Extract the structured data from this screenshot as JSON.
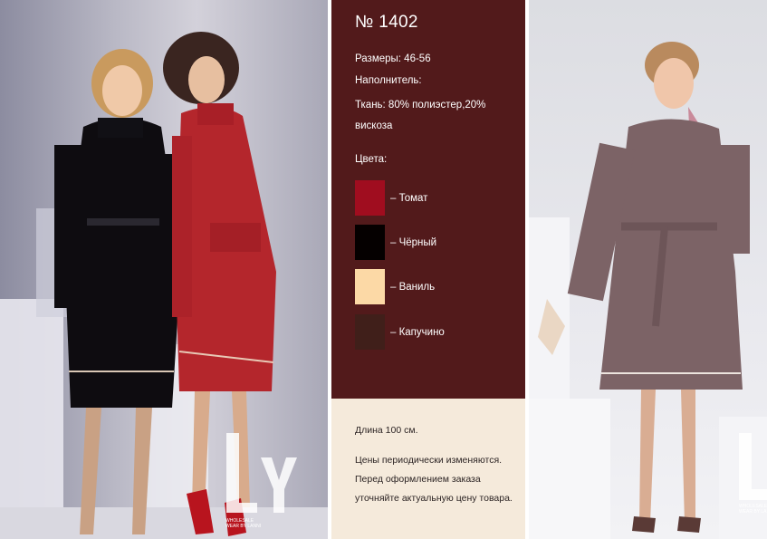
{
  "product": {
    "number": "№ 1402",
    "sizes": "Размеры: 46-56",
    "filler": "Наполнитель:",
    "fabric": "Ткань: 80% полиэстер,20% вискоза"
  },
  "colors_heading": "Цвета:",
  "colors": [
    {
      "label": "– Томат",
      "hex": "#a00d1f"
    },
    {
      "label": "– Чёрный",
      "hex": "#050000"
    },
    {
      "label": "– Ваниль",
      "hex": "#fcd9a6"
    },
    {
      "label": "– Капучино",
      "hex": "#401f1a"
    }
  ],
  "length": "Длина 100 см.",
  "price_note": [
    "Цены периодически изменяются.",
    "Перед оформлением заказа",
    "уточняйте актуальную цену товара."
  ],
  "watermark": {
    "text": "WHOLESALE WEAR BY LANNI",
    "monogram": "LY"
  },
  "panel_colors": {
    "info_top": "#521a1b",
    "info_bottom": "#f5eadb"
  }
}
